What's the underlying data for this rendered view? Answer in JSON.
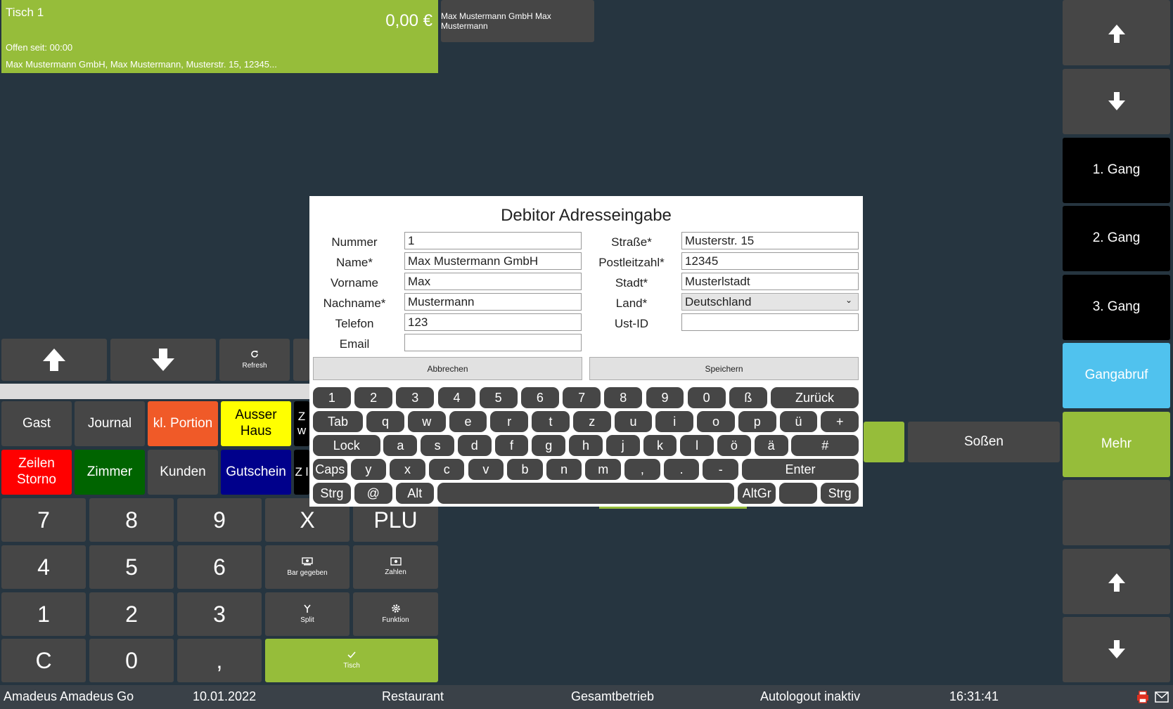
{
  "table": {
    "name": "Tisch 1",
    "amount": "0,00 €",
    "open_since": "Offen seit: 00:00",
    "customer_line": "Max Mustermann GmbH, Max Mustermann, Musterstr. 15, 12345..."
  },
  "customer_tab": "Max Mustermann GmbH Max Mustermann",
  "right_column": {
    "gang1": "1. Gang",
    "gang2": "2. Gang",
    "gang3": "3. Gang",
    "gangabruf": "Gangabruf",
    "mehr": "Mehr"
  },
  "nav": {
    "refresh": "Refresh"
  },
  "functions": {
    "gast": "Gast",
    "journal": "Journal",
    "kl_portion": "kl. Portion",
    "ausser_haus": "Ausser Haus",
    "zeilen_storno": "Zeilen Storno",
    "zimmer": "Zimmer",
    "kunden": "Kunden",
    "gutschein": "Gutschein",
    "cut1": "Z w",
    "cut2": "Z l"
  },
  "keypad": {
    "k7": "7",
    "k8": "8",
    "k9": "9",
    "kx": "X",
    "plu": "PLU",
    "k4": "4",
    "k5": "5",
    "k6": "6",
    "bar_gegeben": "Bar gegeben",
    "zahlen": "Zahlen",
    "k1": "1",
    "k2": "2",
    "k3": "3",
    "split": "Split",
    "funktion": "Funktion",
    "kc": "C",
    "k0": "0",
    "comma": ",",
    "tisch": "Tisch"
  },
  "products": {
    "sossen": "Soßen"
  },
  "modal": {
    "title": "Debitor Adresseingabe",
    "labels": {
      "nummer": "Nummer",
      "name": "Name*",
      "vorname": "Vorname",
      "nachname": "Nachname*",
      "telefon": "Telefon",
      "email": "Email",
      "strasse": "Straße*",
      "plz": "Postleitzahl*",
      "stadt": "Stadt*",
      "land": "Land*",
      "ustid": "Ust-ID"
    },
    "values": {
      "nummer": "1",
      "name": "Max Mustermann GmbH",
      "vorname": "Max",
      "nachname": "Mustermann",
      "telefon": "123",
      "email": "",
      "strasse": "Musterstr. 15",
      "plz": "12345",
      "stadt": "Musterlstadt",
      "land": "Deutschland",
      "ustid": ""
    },
    "cancel": "Abbrechen",
    "save": "Speichern"
  },
  "keyboard": {
    "row1": [
      "1",
      "2",
      "3",
      "4",
      "5",
      "6",
      "7",
      "8",
      "9",
      "0",
      "ß",
      "Zurück"
    ],
    "row2": [
      "Tab",
      "q",
      "w",
      "e",
      "r",
      "t",
      "z",
      "u",
      "i",
      "o",
      "p",
      "ü",
      "+"
    ],
    "row3": [
      "Lock",
      "a",
      "s",
      "d",
      "f",
      "g",
      "h",
      "j",
      "k",
      "l",
      "ö",
      "ä",
      "#"
    ],
    "row4": [
      "Caps",
      "y",
      "x",
      "c",
      "v",
      "b",
      "n",
      "m",
      ",",
      ".",
      "-",
      "Enter"
    ],
    "row5": [
      "Strg",
      "@",
      "Alt",
      " ",
      "AltGr",
      "",
      "Strg"
    ]
  },
  "status": {
    "app": "Amadeus Amadeus Go",
    "date": "10.01.2022",
    "outlet": "Restaurant",
    "mode": "Gesamtbetrieb",
    "logout": "Autologout inaktiv",
    "time": "16:31:41"
  },
  "colors": {
    "background": "#263540",
    "green": "#96bd3a",
    "key": "#464646",
    "blue_btn": "#50c2ee",
    "orange": "#f05a28",
    "yellow": "#ffff00",
    "red": "#ff0000",
    "dark_green": "#006400",
    "navy": "#00008b"
  }
}
